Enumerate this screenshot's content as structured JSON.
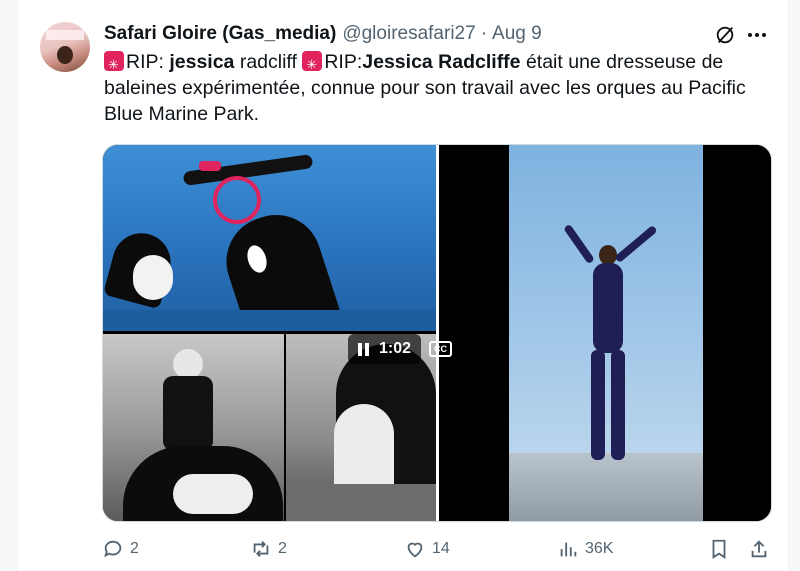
{
  "tweet": {
    "display_name": "Safari Gloire (Gas_media)",
    "handle": "@gloiresafari27",
    "separator": "·",
    "date": "Aug 9",
    "text": {
      "rip1": "RIP: ",
      "bold1": "jessica",
      "plain1": " radcliff ",
      "rip2": "RIP:",
      "bold2": "Jessica Radcliffe",
      "plain2": " était une dresseuse de baleines expérimentée, connue pour son travail avec les orques au Pacific Blue Marine Park."
    }
  },
  "media": {
    "video_time": "1:02",
    "cc_label": "CC"
  },
  "actions": {
    "replies": "2",
    "reposts": "2",
    "likes": "14",
    "views": "36K"
  },
  "icons": [
    "grok-icon",
    "more-icon",
    "siren-emoji",
    "pause-icon",
    "cc-icon",
    "reply-icon",
    "repost-icon",
    "like-icon",
    "views-icon",
    "bookmark-icon",
    "share-icon"
  ],
  "colors": {
    "text": "#0f1419",
    "secondary": "#536471",
    "siren": "#e0245e",
    "water": "#2a74be"
  }
}
